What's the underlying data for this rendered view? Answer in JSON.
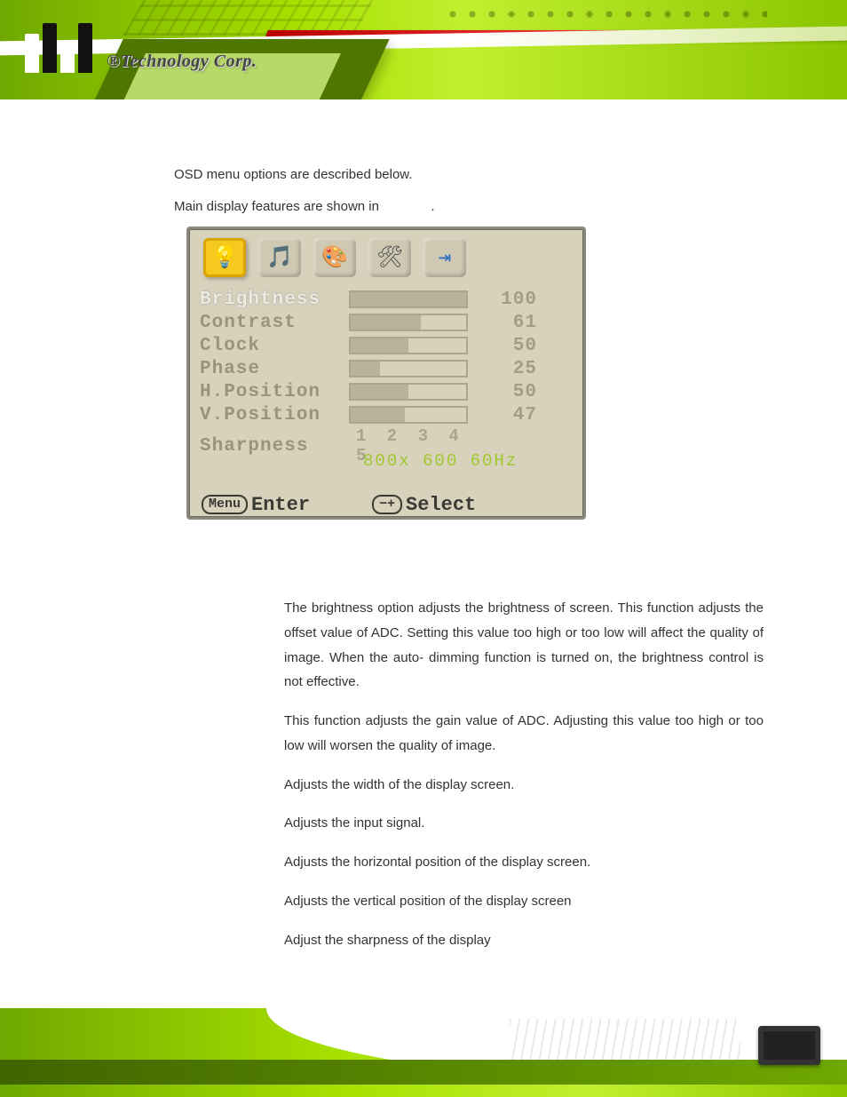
{
  "logo_text": "®Technology Corp.",
  "intro1": "OSD menu options are described below.",
  "intro2_prefix": "Main display features are shown in",
  "intro2_suffix": ".",
  "osd": {
    "rows": [
      {
        "label": "Brightness",
        "value": 100,
        "pct": 100,
        "selected": true
      },
      {
        "label": "Contrast",
        "value": 61,
        "pct": 61
      },
      {
        "label": "Clock",
        "value": 50,
        "pct": 50
      },
      {
        "label": "Phase",
        "value": 25,
        "pct": 25
      },
      {
        "label": "H.Position",
        "value": 50,
        "pct": 50
      },
      {
        "label": "V.Position",
        "value": 47,
        "pct": 47
      }
    ],
    "sharpness_label": "Sharpness",
    "sharpness_scale": "1 2 3 4 5",
    "status": "800x 600 60Hz",
    "footer_enter_key": "Menu",
    "footer_enter": "Enter",
    "footer_select_key": "−+",
    "footer_select": "Select"
  },
  "descriptions": [
    "The brightness option adjusts the brightness of screen. This function adjusts the offset value of ADC. Setting this value too high or too low will affect the quality of image. When the auto- dimming function is turned on, the brightness control is not effective.",
    "This function adjusts the gain value of ADC. Adjusting this value too high or too low will worsen the quality of image.",
    "Adjusts the width of the display screen.",
    "Adjusts the input signal.",
    "Adjusts the horizontal position of the display screen.",
    "Adjusts the vertical position of the display screen",
    "Adjust the sharpness of the display"
  ]
}
